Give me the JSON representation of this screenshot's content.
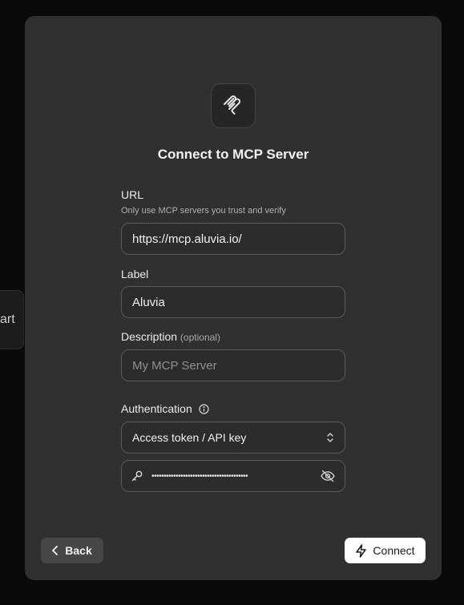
{
  "backdrop": {
    "partial_text": "art"
  },
  "dialog": {
    "title": "Connect to MCP Server",
    "logo_icon": "mcp-logo-icon"
  },
  "form": {
    "url": {
      "label": "URL",
      "hint": "Only use MCP servers you trust and verify",
      "value": "https://mcp.aluvia.io/"
    },
    "label_field": {
      "label": "Label",
      "value": "Aluvia"
    },
    "description": {
      "label": "Description",
      "optional": "(optional)",
      "placeholder": "My MCP Server",
      "value": ""
    },
    "authentication": {
      "label": "Authentication",
      "info_icon": "info-icon",
      "selected": "Access token / API key",
      "token_masked": "••••••••••••••••••••••••••••••••••••••••",
      "key_icon": "key-icon",
      "visibility_icon": "eye-off-icon"
    }
  },
  "footer": {
    "back_label": "Back",
    "connect_label": "Connect"
  },
  "colors": {
    "dialog_bg": "#303030",
    "page_bg": "#0a0a0a",
    "field_border": "#5a5a5a",
    "primary_button_bg": "#ffffff"
  }
}
